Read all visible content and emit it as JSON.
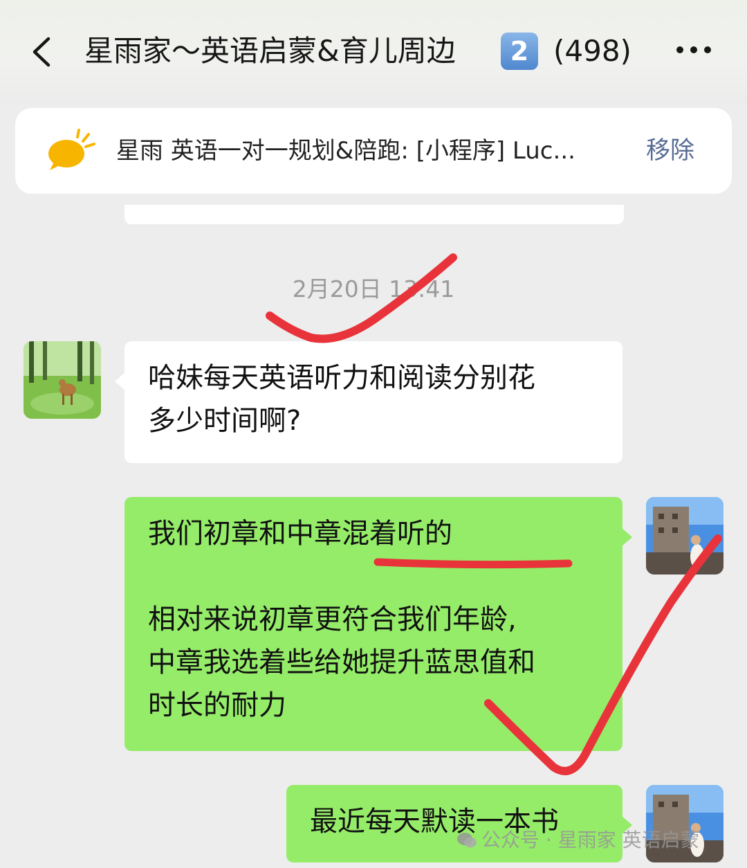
{
  "header": {
    "title": "星雨家～英语启蒙&育儿周边",
    "badge": "2",
    "member_count": "(498)"
  },
  "pinned": {
    "text": "星雨 英语一对一规划&陪跑: [小程序] Luc...",
    "remove_label": "移除"
  },
  "chat": {
    "timestamp": "2月20日 13:41",
    "messages": [
      {
        "side": "left",
        "lines": [
          "哈妹每天英语听力和阅读分别花",
          "多少时间啊?"
        ]
      },
      {
        "side": "right",
        "lines": [
          "我们初章和中章混着听的",
          "",
          "相对来说初章更符合我们年龄,",
          "中章我选着些给她提升蓝思值和",
          "时长的耐力"
        ]
      },
      {
        "side": "right",
        "lines": [
          "最近每天默读一本书"
        ]
      }
    ]
  },
  "watermark": {
    "text": "公众号 · 星雨家 英语启蒙"
  },
  "colors": {
    "bubble_out": "#95ec69",
    "annotation_red": "#e8333a",
    "link_blue": "#576b95"
  },
  "icons": [
    "back-icon",
    "more-icon",
    "announcement-icon",
    "wechat-icon"
  ]
}
